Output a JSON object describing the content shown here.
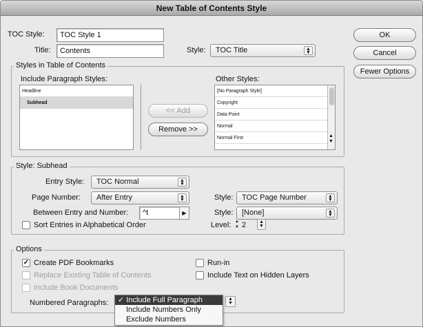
{
  "window": {
    "title": "New Table of Contents Style"
  },
  "toc_style": {
    "label": "TOC Style:",
    "value": "TOC Style 1"
  },
  "title_row": {
    "label": "Title:",
    "value": "Contents",
    "style_label": "Style:",
    "style_value": "TOC Title"
  },
  "buttons": {
    "ok": "OK",
    "cancel": "Cancel",
    "fewer_options": "Fewer Options",
    "add": "<< Add",
    "remove": "Remove >>"
  },
  "styles_group": {
    "title": "Styles in Table of Contents",
    "include_label": "Include Paragraph Styles:",
    "include_items": [
      "Headline",
      "Subhead"
    ],
    "other_label": "Other Styles:",
    "other_items": [
      "[No Paragraph Style]",
      "Copyright",
      "Data Point",
      "Normal",
      "Normal First"
    ]
  },
  "style_subhead": {
    "title": "Style: Subhead",
    "entry_style_label": "Entry Style:",
    "entry_style_value": "TOC Normal",
    "page_number_label": "Page Number:",
    "page_number_value": "After Entry",
    "page_style_label": "Style:",
    "page_style_value": "TOC Page Number",
    "between_label": "Between Entry and Number:",
    "between_value": "^t",
    "between_style_label": "Style:",
    "between_style_value": "[None]",
    "sort_label": "Sort Entries in Alphabetical Order",
    "level_label": "Level:",
    "level_value": "2"
  },
  "options": {
    "title": "Options",
    "create_pdf": "Create PDF Bookmarks",
    "replace_existing": "Replace Existing Table of Contents",
    "include_book": "Include Book Documents",
    "run_in": "Run-in",
    "include_hidden": "Include Text on Hidden Layers",
    "numbered_label": "Numbered Paragraphs:",
    "numbered_menu": [
      "Include Full Paragraph",
      "Include Numbers Only",
      "Exclude Numbers"
    ],
    "checkmark": "✓"
  }
}
